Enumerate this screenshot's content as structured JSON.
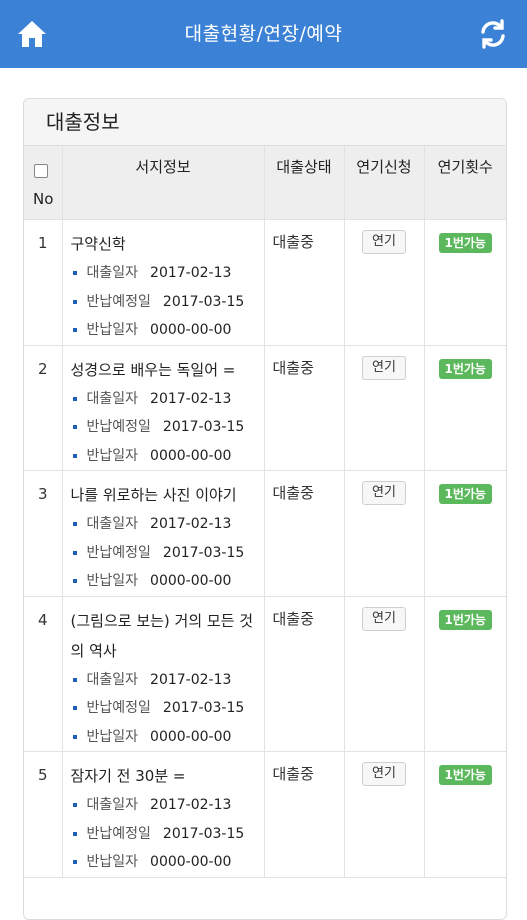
{
  "header": {
    "title": "대출현황/연장/예약",
    "home_icon": "home-icon",
    "refresh_icon": "refresh-icon",
    "bar_color": "#3b82d6"
  },
  "panel": {
    "title": "대출정보"
  },
  "table": {
    "headers": {
      "no": "No",
      "book": "서지정보",
      "status": "대출상태",
      "extend": "연기신청",
      "count": "연기횟수"
    },
    "labels": {
      "loan_date": "대출일자",
      "due_date": "반납예정일",
      "return_date": "반납일자"
    },
    "rows": [
      {
        "no": "1",
        "title": "구약신학",
        "loan_date": "2017-02-13",
        "due_date": "2017-03-15",
        "return_date": "0000-00-00",
        "status": "대출중",
        "extend_label": "연기",
        "count_label": "1번가능"
      },
      {
        "no": "2",
        "title": "성경으로 배우는 독일어 =",
        "loan_date": "2017-02-13",
        "due_date": "2017-03-15",
        "return_date": "0000-00-00",
        "status": "대출중",
        "extend_label": "연기",
        "count_label": "1번가능"
      },
      {
        "no": "3",
        "title": "나를 위로하는 사진 이야기",
        "loan_date": "2017-02-13",
        "due_date": "2017-03-15",
        "return_date": "0000-00-00",
        "status": "대출중",
        "extend_label": "연기",
        "count_label": "1번가능"
      },
      {
        "no": "4",
        "title": "(그림으로 보는) 거의 모든 것의 역사",
        "loan_date": "2017-02-13",
        "due_date": "2017-03-15",
        "return_date": "0000-00-00",
        "status": "대출중",
        "extend_label": "연기",
        "count_label": "1번가능"
      },
      {
        "no": "5",
        "title": "잠자기 전 30분 =",
        "loan_date": "2017-02-13",
        "due_date": "2017-03-15",
        "return_date": "0000-00-00",
        "status": "대출중",
        "extend_label": "연기",
        "count_label": "1번가능"
      }
    ]
  },
  "colors": {
    "badge": "#5cb85c",
    "bullet": "#1f5fb8"
  }
}
